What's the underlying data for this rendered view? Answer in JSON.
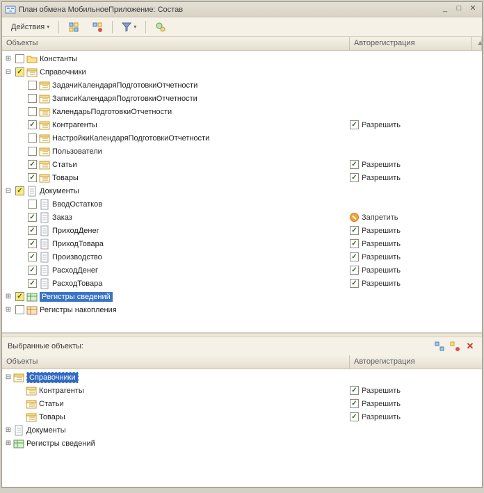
{
  "window": {
    "title": "План обмена МобильноеПриложение: Состав"
  },
  "toolbar": {
    "actions_label": "Действия"
  },
  "columns": {
    "objects": "Объекты",
    "autoreg": "Авторегистрация"
  },
  "autoreg": {
    "allow": "Разрешить",
    "deny": "Запретить"
  },
  "selected_header": "Выбранные объекты:",
  "tree": [
    {
      "id": "const",
      "level": 0,
      "expander": "plus",
      "chk": "off",
      "icon": "folder",
      "label": "Константы"
    },
    {
      "id": "spr",
      "level": 0,
      "expander": "minus",
      "chk": "yellow",
      "icon": "catalog",
      "label": "Справочники"
    },
    {
      "id": "spr1",
      "level": 1,
      "expander": "",
      "chk": "off",
      "icon": "catalog",
      "label": "ЗадачиКалендаряПодготовкиОтчетности"
    },
    {
      "id": "spr2",
      "level": 1,
      "expander": "",
      "chk": "off",
      "icon": "catalog",
      "label": "ЗаписиКалендаряПодготовкиОтчетности"
    },
    {
      "id": "spr3",
      "level": 1,
      "expander": "",
      "chk": "off",
      "icon": "catalog",
      "label": "КалендарьПодготовкиОтчетности"
    },
    {
      "id": "spr4",
      "level": 1,
      "expander": "",
      "chk": "on",
      "icon": "catalog",
      "label": "Контрагенты",
      "auto": "allow"
    },
    {
      "id": "spr5",
      "level": 1,
      "expander": "",
      "chk": "off",
      "icon": "catalog",
      "label": "НастройкиКалендаряПодготовкиОтчетности"
    },
    {
      "id": "spr6",
      "level": 1,
      "expander": "",
      "chk": "off",
      "icon": "catalog",
      "label": "Пользователи"
    },
    {
      "id": "spr7",
      "level": 1,
      "expander": "",
      "chk": "on",
      "icon": "catalog",
      "label": "Статьи",
      "auto": "allow"
    },
    {
      "id": "spr8",
      "level": 1,
      "expander": "",
      "chk": "on",
      "icon": "catalog",
      "label": "Товары",
      "auto": "allow"
    },
    {
      "id": "doc",
      "level": 0,
      "expander": "minus",
      "chk": "yellow",
      "icon": "doc",
      "label": "Документы"
    },
    {
      "id": "doc1",
      "level": 1,
      "expander": "",
      "chk": "off",
      "icon": "doc",
      "label": "ВводОстатков"
    },
    {
      "id": "doc2",
      "level": 1,
      "expander": "",
      "chk": "on",
      "icon": "doc",
      "label": "Заказ",
      "auto": "deny"
    },
    {
      "id": "doc3",
      "level": 1,
      "expander": "",
      "chk": "on",
      "icon": "doc",
      "label": "ПриходДенег",
      "auto": "allow"
    },
    {
      "id": "doc4",
      "level": 1,
      "expander": "",
      "chk": "on",
      "icon": "doc",
      "label": "ПриходТовара",
      "auto": "allow"
    },
    {
      "id": "doc5",
      "level": 1,
      "expander": "",
      "chk": "on",
      "icon": "doc",
      "label": "Производство",
      "auto": "allow"
    },
    {
      "id": "doc6",
      "level": 1,
      "expander": "",
      "chk": "on",
      "icon": "doc",
      "label": "РасходДенег",
      "auto": "allow"
    },
    {
      "id": "doc7",
      "level": 1,
      "expander": "",
      "chk": "on",
      "icon": "doc",
      "label": "РасходТовара",
      "auto": "allow"
    },
    {
      "id": "reg1",
      "level": 0,
      "expander": "plus",
      "chk": "yellow",
      "icon": "inforeg",
      "label": "Регистры сведений",
      "selected": true
    },
    {
      "id": "reg2",
      "level": 0,
      "expander": "plus",
      "chk": "off",
      "icon": "accreg",
      "label": "Регистры накопления"
    }
  ],
  "selected_tree": [
    {
      "id": "sspr",
      "level": 0,
      "expander": "minus",
      "icon": "catalog",
      "label": "Справочники",
      "selected": true
    },
    {
      "id": "sspr1",
      "level": 1,
      "expander": "",
      "icon": "catalog",
      "label": "Контрагенты",
      "auto": "allow"
    },
    {
      "id": "sspr2",
      "level": 1,
      "expander": "",
      "icon": "catalog",
      "label": "Статьи",
      "auto": "allow"
    },
    {
      "id": "sspr3",
      "level": 1,
      "expander": "",
      "icon": "catalog",
      "label": "Товары",
      "auto": "allow"
    },
    {
      "id": "sdoc",
      "level": 0,
      "expander": "plus",
      "icon": "doc",
      "label": "Документы"
    },
    {
      "id": "sreg",
      "level": 0,
      "expander": "plus",
      "icon": "inforeg",
      "label": "Регистры сведений"
    }
  ]
}
